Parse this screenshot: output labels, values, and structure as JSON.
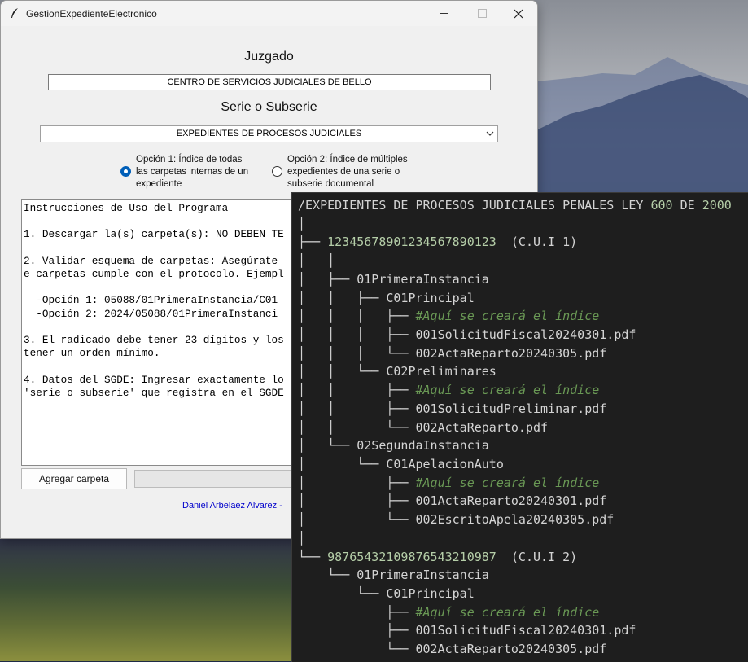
{
  "window": {
    "title": "GestionExpedienteElectronico",
    "court_label": "Juzgado",
    "court_value": "CENTRO DE SERVICIOS JUDICIALES DE BELLO",
    "serie_label": "Serie o Subserie",
    "serie_value": "EXPEDIENTES DE PROCESOS JUDICIALES",
    "option1": "Opción 1: Índice de todas\nlas carpetas internas de un\nexpediente",
    "option2": "Opción 2: Índice de múltiples\nexpedientes de una serie o\nsubserie documental",
    "instructions": [
      "Instrucciones de Uso del Programa",
      "",
      "1. Descargar la(s) carpeta(s): NO DEBEN TE",
      "",
      "2. Validar esquema de carpetas: Asegúrate",
      "e carpetas cumple con el protocolo. Ejempl",
      "",
      "  -Opción 1: 05088/01PrimeraInstancia/C01",
      "  -Opción 2: 2024/05088/01PrimeraInstanci",
      "",
      "3. El radicado debe tener 23 dígitos y los",
      "tener un orden mínimo.",
      "",
      "4. Datos del SGDE: Ingresar exactamente lo",
      "'serie o subserie' que registra en el SGDE"
    ],
    "add_button": "Agregar carpeta",
    "author": "Daniel Arbelaez Alvarez -"
  },
  "terminal": {
    "header": {
      "path": "/EXPEDIENTES DE PROCESOS JUDICIALES PENALES LEY ",
      "num1": "600",
      "mid": " DE ",
      "num2": "2000"
    },
    "case1": {
      "id": "12345678901234567890123",
      "label": "  (C.U.I 1)"
    },
    "case2": {
      "id": "98765432109876543210987",
      "label": "  (C.U.I 2)"
    },
    "folders": {
      "primera": "01PrimeraInstancia",
      "segunda": "02SegundaInstancia",
      "principal": "C01Principal",
      "preliminares": "C02Preliminares",
      "apelacion": "C01ApelacionAuto"
    },
    "index_comment": "#Aquí se creará el índice",
    "files": {
      "f1": "001SolicitudFiscal20240301.pdf",
      "f2": "002ActaReparto20240305.pdf",
      "f3": "001SolicitudPreliminar.pdf",
      "f4": "002ActaReparto.pdf",
      "f5": "001ActaReparto20240301.pdf",
      "f6": "002EscritoApela20240305.pdf",
      "f7": "001SolicitudFiscal20240301.pdf",
      "f8": "002ActaReparto20240305.pdf"
    }
  },
  "colors": {
    "accent": "#005fb8",
    "terminal_bg": "#1e1e1e",
    "number": "#b5cea8",
    "comment": "#6a9955",
    "link": "#0000cc"
  }
}
